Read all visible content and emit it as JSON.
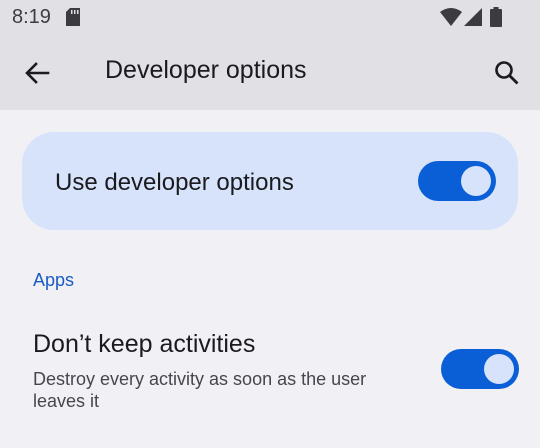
{
  "status_bar": {
    "time": "8:19",
    "icons": [
      "sd-card-icon",
      "wifi-icon",
      "cell-signal-icon",
      "battery-icon"
    ]
  },
  "app_bar": {
    "back_icon": "arrow-back-icon",
    "title": "Developer options",
    "search_icon": "search-icon"
  },
  "main_switch": {
    "label": "Use developer options",
    "checked": true
  },
  "sections": [
    {
      "header": "Apps",
      "items": [
        {
          "title": "Don’t keep activities",
          "summary": "Destroy every activity as soon as the user leaves it",
          "checked": true
        }
      ]
    }
  ],
  "colors": {
    "accent": "#0a5fd7",
    "card_background": "#d6e3fb",
    "section_header": "#1a5bc4",
    "background": "#f1f0f4",
    "app_bar": "#e1e1e5"
  }
}
